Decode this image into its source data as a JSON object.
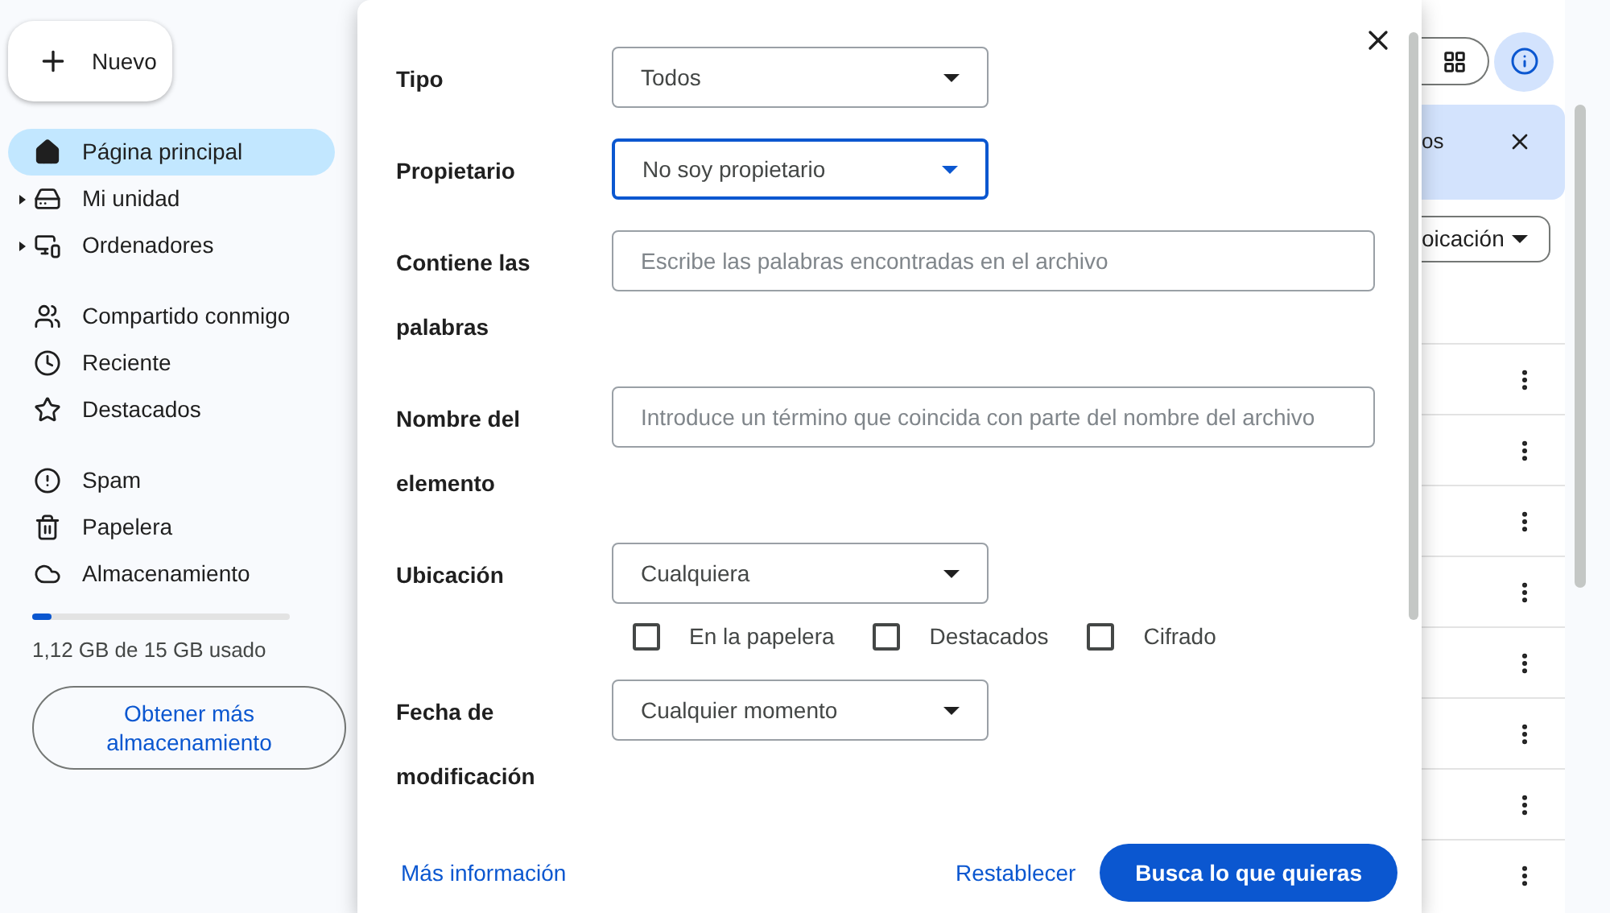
{
  "sidebar": {
    "new_button": {
      "label": "Nuevo"
    },
    "groups": [
      [
        {
          "label": "Página principal",
          "selected": true,
          "expandable": false
        },
        {
          "label": "Mi unidad",
          "selected": false,
          "expandable": true
        },
        {
          "label": "Ordenadores",
          "selected": false,
          "expandable": true
        }
      ],
      [
        {
          "label": "Compartido conmigo",
          "selected": false,
          "expandable": false
        },
        {
          "label": "Reciente",
          "selected": false,
          "expandable": false
        },
        {
          "label": "Destacados",
          "selected": false,
          "expandable": false
        }
      ],
      [
        {
          "label": "Spam",
          "selected": false,
          "expandable": false
        },
        {
          "label": "Papelera",
          "selected": false,
          "expandable": false
        },
        {
          "label": "Almacenamiento",
          "selected": false,
          "expandable": false
        }
      ]
    ],
    "storage": {
      "level": 0.075,
      "usage": "1,12 GB de 15 GB usado",
      "button": "Obtener más almacenamiento"
    }
  },
  "search_dialog": {
    "fields": [
      {
        "label": "Tipo",
        "kind": "select",
        "value": "Todos",
        "focused": false
      },
      {
        "label": "Propietario",
        "kind": "select",
        "value": "No soy propietario",
        "focused": true
      },
      {
        "label": "Contiene las palabras",
        "kind": "text",
        "placeholder": "Escribe las palabras encontradas en el archivo",
        "focused": false
      },
      {
        "label": "Nombre del elemento",
        "kind": "text",
        "placeholder": "Introduce un término que coincida con parte del nombre del archivo",
        "focused": false
      },
      {
        "label": "Ubicación",
        "kind": "select",
        "value": "Cualquiera",
        "focused": false,
        "options": [
          {
            "label": "En la papelera",
            "checked": false
          },
          {
            "label": "Destacados",
            "checked": false
          },
          {
            "label": "Cifrado",
            "checked": false
          }
        ]
      },
      {
        "label": "Fecha de modificación",
        "kind": "select",
        "value": "Cualquier momento",
        "focused": false
      }
    ],
    "footer": {
      "link": "Más información",
      "reset": "Restablecer",
      "submit": "Busca lo que quieras"
    }
  },
  "background": {
    "banner": {
      "text": "os"
    },
    "filter_chip": {
      "label": "oicación"
    }
  }
}
